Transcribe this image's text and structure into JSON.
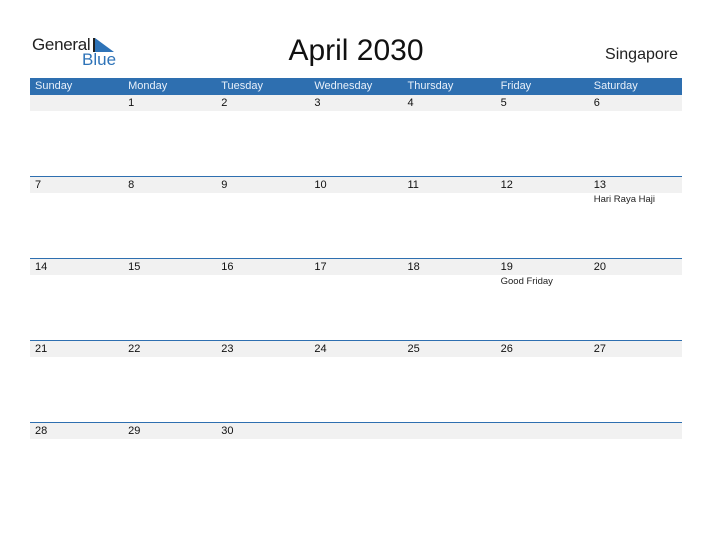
{
  "logo": {
    "general": "General",
    "blue": "Blue"
  },
  "title": "April 2030",
  "country": "Singapore",
  "colors": {
    "accent": "#2e6fb0",
    "band": "#f1f1f1"
  },
  "weekdays": [
    "Sunday",
    "Monday",
    "Tuesday",
    "Wednesday",
    "Thursday",
    "Friday",
    "Saturday"
  ],
  "weeks": [
    [
      {
        "d": ""
      },
      {
        "d": "1"
      },
      {
        "d": "2"
      },
      {
        "d": "3"
      },
      {
        "d": "4"
      },
      {
        "d": "5"
      },
      {
        "d": "6"
      }
    ],
    [
      {
        "d": "7"
      },
      {
        "d": "8"
      },
      {
        "d": "9"
      },
      {
        "d": "10"
      },
      {
        "d": "11"
      },
      {
        "d": "12"
      },
      {
        "d": "13",
        "ev": "Hari Raya Haji"
      }
    ],
    [
      {
        "d": "14"
      },
      {
        "d": "15"
      },
      {
        "d": "16"
      },
      {
        "d": "17"
      },
      {
        "d": "18"
      },
      {
        "d": "19",
        "ev": "Good Friday"
      },
      {
        "d": "20"
      }
    ],
    [
      {
        "d": "21"
      },
      {
        "d": "22"
      },
      {
        "d": "23"
      },
      {
        "d": "24"
      },
      {
        "d": "25"
      },
      {
        "d": "26"
      },
      {
        "d": "27"
      }
    ],
    [
      {
        "d": "28"
      },
      {
        "d": "29"
      },
      {
        "d": "30"
      },
      {
        "d": ""
      },
      {
        "d": ""
      },
      {
        "d": ""
      },
      {
        "d": ""
      }
    ]
  ]
}
